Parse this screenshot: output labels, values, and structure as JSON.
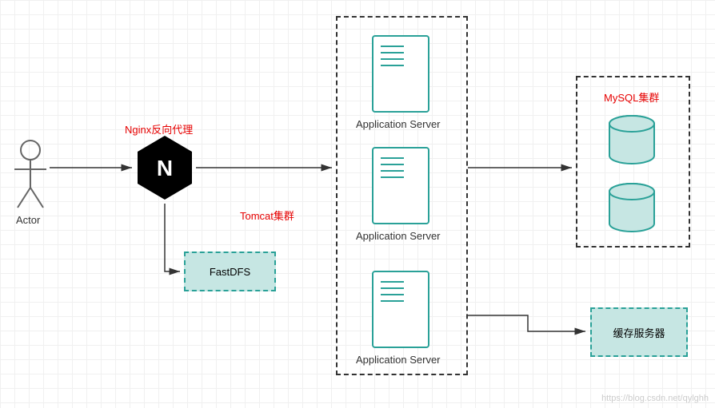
{
  "actor": {
    "label": "Actor"
  },
  "nginx": {
    "label": "Nginx反向代理"
  },
  "tomcat": {
    "label": "Tomcat集群"
  },
  "fastdfs": {
    "label": "FastDFS"
  },
  "appserver1": {
    "label": "Application Server"
  },
  "appserver2": {
    "label": "Application Server"
  },
  "appserver3": {
    "label": "Application Server"
  },
  "mysql": {
    "label": "MySQL集群"
  },
  "cache": {
    "label": "缓存服务器"
  },
  "watermark": "https://blog.csdn.net/qylghh"
}
